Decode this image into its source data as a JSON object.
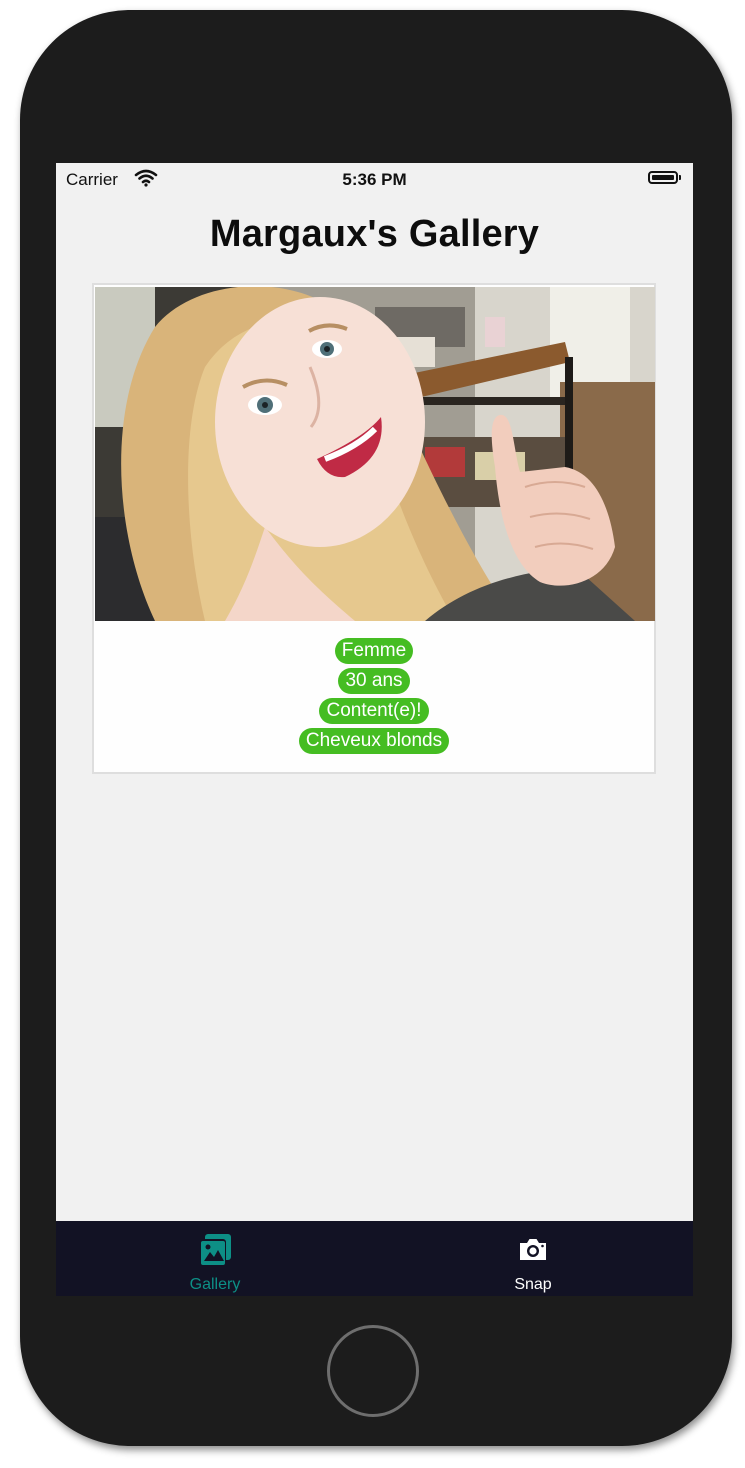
{
  "status_bar": {
    "carrier": "Carrier",
    "time": "5:36 PM"
  },
  "header": {
    "title": "Margaux's Gallery"
  },
  "gallery": {
    "cards": [
      {
        "photo_icon": "selfie-photo",
        "tags": [
          "Femme",
          "30 ans",
          "Content(e)!",
          "Cheveux blonds"
        ]
      }
    ]
  },
  "tab_bar": {
    "tabs": [
      {
        "label": "Gallery",
        "icon": "gallery-icon",
        "active": true
      },
      {
        "label": "Snap",
        "icon": "camera-icon",
        "active": false
      }
    ]
  },
  "colors": {
    "tag_background": "#45bd22",
    "tab_bar_background": "#121224",
    "tab_active": "#0d8f86",
    "tab_inactive": "#ffffff",
    "screen_background": "#f1f1f1"
  }
}
